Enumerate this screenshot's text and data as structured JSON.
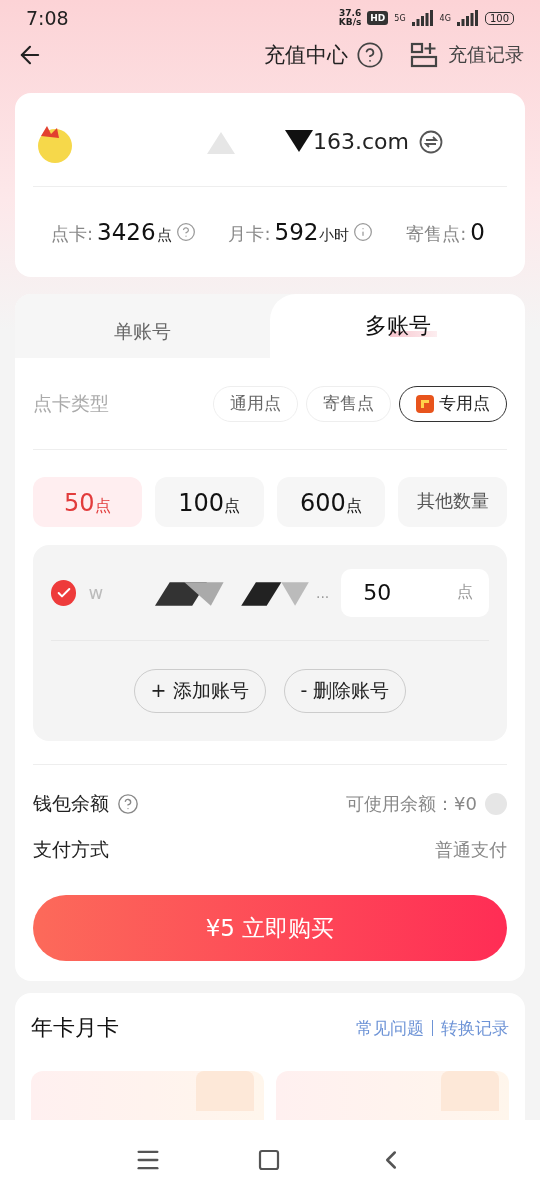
{
  "status_bar": {
    "time": "7:08",
    "net_speed": "37.6",
    "net_unit": "KB/s",
    "hd": "HD",
    "network_1": "5G",
    "network_2": "4G",
    "battery": "100"
  },
  "header": {
    "title": "充值中心",
    "record_link": "充值记录"
  },
  "account": {
    "email_visible": "163.com",
    "stats": [
      {
        "label": "点卡:",
        "value": "3426",
        "unit": "点",
        "kind": "help"
      },
      {
        "label": "月卡:",
        "value": "592",
        "unit": "小时",
        "kind": "info"
      },
      {
        "label": "寄售点:",
        "value": "0",
        "kind": "plain"
      }
    ]
  },
  "mode_tabs": [
    {
      "label": "单账号",
      "selected": false
    },
    {
      "label": "多账号",
      "selected": true
    }
  ],
  "card_type": {
    "label": "点卡类型",
    "options": [
      {
        "label": "通用点",
        "selected": false,
        "kind": "plain"
      },
      {
        "label": "寄售点",
        "selected": false,
        "kind": "plain"
      },
      {
        "label": "专用点",
        "selected": true,
        "kind": "app"
      }
    ]
  },
  "amounts": [
    {
      "kind": "preset",
      "value": "50",
      "unit": "点",
      "selected": true
    },
    {
      "kind": "preset",
      "value": "100",
      "unit": "点",
      "selected": false
    },
    {
      "kind": "preset",
      "value": "600",
      "unit": "点",
      "selected": false
    },
    {
      "kind": "custom",
      "label": "其他数量",
      "selected": false
    }
  ],
  "accounts": [
    {
      "name": "w",
      "ellipsis": "...",
      "checked": true,
      "amount": "50",
      "unit": "点"
    }
  ],
  "account_actions": [
    "+ 添加账号",
    "- 删除账号"
  ],
  "wallet": {
    "label": "钱包余额",
    "available": "可使用余额：¥0",
    "on": false
  },
  "payment": {
    "label": "支付方式",
    "value": "普通支付"
  },
  "buy_button": "¥5 立即购买",
  "annual": {
    "title": "年卡月卡",
    "links": [
      "常见问题",
      "转换记录"
    ]
  }
}
